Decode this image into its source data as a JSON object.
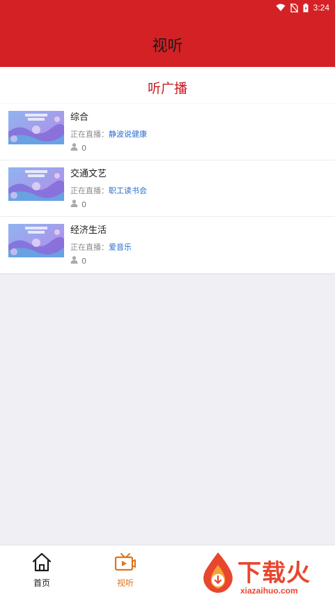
{
  "status_bar": {
    "time": "3:24"
  },
  "header": {
    "title": "视听"
  },
  "section": {
    "title": "听广播"
  },
  "stations": [
    {
      "name": "综合",
      "now_label": "正在直播：",
      "program": "静波说健康",
      "listeners": "0"
    },
    {
      "name": "交通文艺",
      "now_label": "正在直播：",
      "program": "职工读书会",
      "listeners": "0"
    },
    {
      "name": "经济生活",
      "now_label": "正在直播：",
      "program": "爱音乐",
      "listeners": "0"
    }
  ],
  "tabbar": {
    "tabs": [
      {
        "label": "首页",
        "icon": "home-icon",
        "active": false
      },
      {
        "label": "视听",
        "icon": "tv-icon",
        "active": true
      }
    ]
  },
  "watermark": {
    "text": "下载火",
    "url": "xiazaihuo.com"
  },
  "colors": {
    "header": "#d42125",
    "section_title": "#c8171f",
    "program_link": "#2a6fd1",
    "active_tab": "#e0731b",
    "watermark": "#e8462e"
  }
}
